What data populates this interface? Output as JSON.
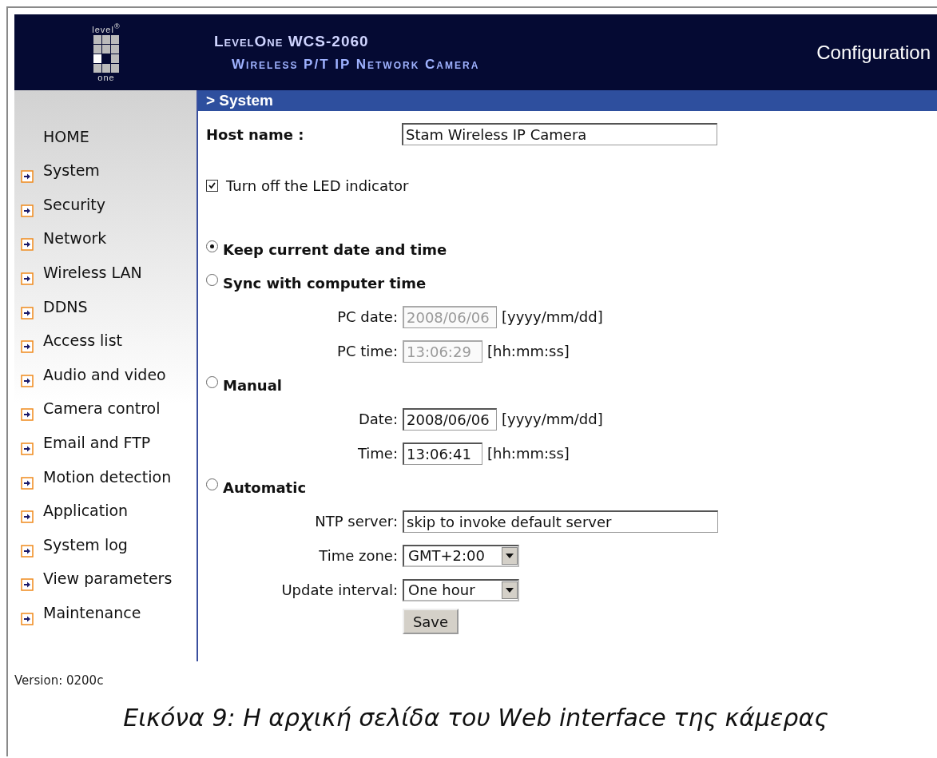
{
  "header": {
    "logo_top": "level",
    "logo_mark": "®",
    "logo_bottom": "one",
    "title": "LevelOne WCS-2060",
    "subtitle": "Wireless P/T IP Network Camera",
    "section": "Configuration"
  },
  "sidebar": {
    "items": [
      {
        "label": "HOME",
        "kind": "plain"
      },
      {
        "label": "System",
        "kind": "arrow"
      },
      {
        "label": "Security",
        "kind": "arrow"
      },
      {
        "label": "Network",
        "kind": "arrow"
      },
      {
        "label": "Wireless LAN",
        "kind": "arrow"
      },
      {
        "label": "DDNS",
        "kind": "arrow"
      },
      {
        "label": "Access list",
        "kind": "arrow"
      },
      {
        "label": "Audio and video",
        "kind": "arrow"
      },
      {
        "label": "Camera control",
        "kind": "arrow"
      },
      {
        "label": "Email and FTP",
        "kind": "arrow"
      },
      {
        "label": "Motion detection",
        "kind": "arrow"
      },
      {
        "label": "Application",
        "kind": "arrow"
      },
      {
        "label": "System log",
        "kind": "arrow"
      },
      {
        "label": "View parameters",
        "kind": "arrow"
      },
      {
        "label": "Maintenance",
        "kind": "arrow"
      }
    ]
  },
  "page_title": "> System",
  "host_name": {
    "label": "Host name :",
    "value": "Stam Wireless IP Camera"
  },
  "led": {
    "label": "Turn off the LED indicator",
    "checked": true
  },
  "time_modes": [
    {
      "label": "Keep current date and time",
      "selected": true
    },
    {
      "label": "Sync with computer time",
      "selected": false,
      "fields": [
        {
          "label": "PC date:",
          "value": "2008/06/06",
          "hint": "[yyyy/mm/dd]",
          "kind": "text",
          "disabled": true
        },
        {
          "label": "PC time:",
          "value": "13:06:29",
          "hint": "[hh:mm:ss]",
          "kind": "text",
          "disabled": true
        }
      ]
    },
    {
      "label": "Manual",
      "selected": false,
      "fields": [
        {
          "label": "Date:",
          "value": "2008/06/06",
          "hint": "[yyyy/mm/dd]",
          "kind": "text",
          "disabled": false
        },
        {
          "label": "Time:",
          "value": "13:06:41",
          "hint": "[hh:mm:ss]",
          "kind": "text",
          "disabled": false
        }
      ]
    },
    {
      "label": "Automatic",
      "selected": false,
      "fields": [
        {
          "label": "NTP server:",
          "value": "skip to invoke default server",
          "kind": "wide",
          "disabled": false
        },
        {
          "label": "Time zone:",
          "value": "GMT+2:00",
          "kind": "select",
          "disabled": false
        },
        {
          "label": "Update interval:",
          "value": "One hour",
          "kind": "select",
          "disabled": false
        }
      ]
    }
  ],
  "save_button": "Save",
  "version": "Version: 0200c",
  "caption": "Εικόνα 9: Η αρχική σελίδα του Web interface της κάμερας"
}
